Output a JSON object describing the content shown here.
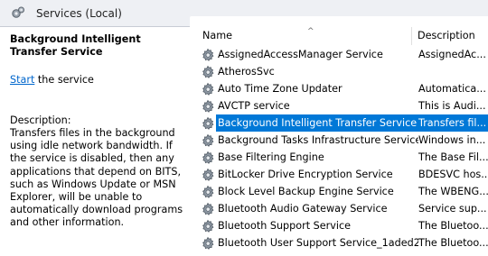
{
  "header": {
    "title": "Services (Local)",
    "icon": "gears-icon"
  },
  "left_pane": {
    "service_title": "Background Intelligent Transfer Service",
    "start_link": "Start",
    "start_suffix": " the service",
    "description_label": "Description:",
    "description_text": "Transfers files in the background using idle network bandwidth. If the service is disabled, then any applications that depend on BITS, such as Windows Update or MSN Explorer, will be unable to automatically download programs and other information."
  },
  "list": {
    "columns": {
      "name": "Name",
      "description": "Description"
    },
    "rows": [
      {
        "name": "AssignedAccessManager Service",
        "description": "AssignedAc..."
      },
      {
        "name": "AtherosSvc",
        "description": ""
      },
      {
        "name": "Auto Time Zone Updater",
        "description": "Automatica..."
      },
      {
        "name": "AVCTP service",
        "description": "This is Audi..."
      },
      {
        "name": "Background Intelligent Transfer Service",
        "description": "Transfers fil..."
      },
      {
        "name": "Background Tasks Infrastructure Service",
        "description": "Windows in..."
      },
      {
        "name": "Base Filtering Engine",
        "description": "The Base Fil..."
      },
      {
        "name": "BitLocker Drive Encryption Service",
        "description": "BDESVC hos..."
      },
      {
        "name": "Block Level Backup Engine Service",
        "description": "The WBENG..."
      },
      {
        "name": "Bluetooth Audio Gateway Service",
        "description": "Service sup..."
      },
      {
        "name": "Bluetooth Support Service",
        "description": "The Bluetoo..."
      },
      {
        "name": "Bluetooth User Support Service_1aded2d",
        "description": "The Bluetoo..."
      }
    ],
    "selected_index": 4
  },
  "colors": {
    "selection": "#0078d7",
    "link": "#0066cc",
    "header_bg": "#eef0f4"
  }
}
